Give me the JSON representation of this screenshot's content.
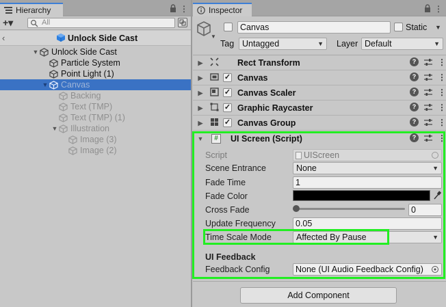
{
  "hierarchy": {
    "tab_label": "Hierarchy",
    "add_label": "+▾",
    "search_placeholder": "All",
    "scene_title": "Unlock Side Cast",
    "items": [
      {
        "label": "Unlock Side Cast",
        "depth": 0,
        "foldout": "open",
        "dim": false,
        "selected": false
      },
      {
        "label": "Particle System",
        "depth": 1,
        "foldout": "none",
        "dim": false,
        "selected": false
      },
      {
        "label": "Point Light (1)",
        "depth": 1,
        "foldout": "none",
        "dim": false,
        "selected": false
      },
      {
        "label": "Canvas",
        "depth": 1,
        "foldout": "open",
        "dim": true,
        "selected": true
      },
      {
        "label": "Backing",
        "depth": 2,
        "foldout": "none",
        "dim": true,
        "selected": false
      },
      {
        "label": "Text (TMP)",
        "depth": 2,
        "foldout": "none",
        "dim": true,
        "selected": false
      },
      {
        "label": "Text (TMP) (1)",
        "depth": 2,
        "foldout": "none",
        "dim": true,
        "selected": false
      },
      {
        "label": "Illustration",
        "depth": 2,
        "foldout": "open",
        "dim": true,
        "selected": false
      },
      {
        "label": "Image (3)",
        "depth": 3,
        "foldout": "none",
        "dim": true,
        "selected": false
      },
      {
        "label": "Image (2)",
        "depth": 3,
        "foldout": "none",
        "dim": true,
        "selected": false
      }
    ]
  },
  "inspector": {
    "tab_label": "Inspector",
    "object_name": "Canvas",
    "static_label": "Static",
    "tag_label": "Tag",
    "tag_value": "Untagged",
    "layer_label": "Layer",
    "layer_value": "Default",
    "components": [
      {
        "name": "Rect Transform",
        "has_checkbox": false,
        "icon": "rect-transform-icon"
      },
      {
        "name": "Canvas",
        "has_checkbox": true,
        "icon": "canvas-icon"
      },
      {
        "name": "Canvas Scaler",
        "has_checkbox": true,
        "icon": "canvas-scaler-icon"
      },
      {
        "name": "Graphic Raycaster",
        "has_checkbox": true,
        "icon": "graphic-raycaster-icon"
      },
      {
        "name": "Canvas Group",
        "has_checkbox": true,
        "icon": "canvas-group-icon"
      }
    ],
    "ui_screen": {
      "title": "UI Screen (Script)",
      "script_label": "Script",
      "script_value": "UIScreen",
      "scene_entrance_label": "Scene Entrance",
      "scene_entrance_value": "None",
      "fade_time_label": "Fade Time",
      "fade_time_value": "1",
      "fade_color_label": "Fade Color",
      "fade_color_value": "#000000",
      "cross_fade_label": "Cross Fade",
      "cross_fade_value": "0",
      "update_frequency_label": "Update Frequency",
      "update_frequency_value": "0.05",
      "time_scale_mode_label": "Time Scale Mode",
      "time_scale_mode_value": "Affected By Pause",
      "ui_feedback_header": "UI Feedback",
      "feedback_config_label": "Feedback Config",
      "feedback_config_value": "None (UI Audio Feedback Config)"
    },
    "add_component_label": "Add Component"
  },
  "colors": {
    "selection_blue": "#3a72c4",
    "highlight_green": "#22ee22",
    "cube_blue": "#2c7fe0",
    "tab_accent": "#3d7fd6"
  }
}
